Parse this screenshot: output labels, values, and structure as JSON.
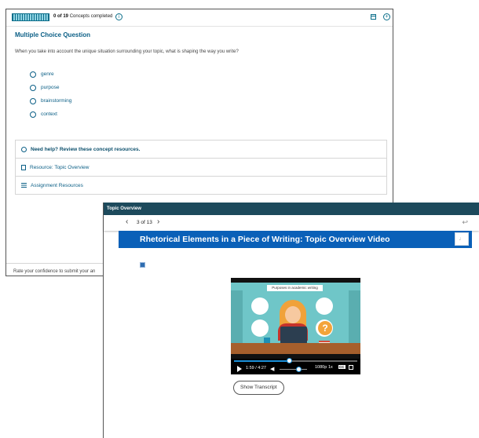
{
  "quiz": {
    "progress_fraction": 0.0,
    "concepts_prefix": "0 of 19",
    "concepts_suffix": "Concepts completed",
    "info_icon": "info-icon",
    "calendar_icon": "calendar-icon",
    "add_icon": "plus-circle-icon",
    "question_type": "Multiple Choice Question",
    "question": "When you take into account the unique situation surrounding your topic, what is shaping the way you write?",
    "options": [
      "genre",
      "purpose",
      "brainstorming",
      "context"
    ],
    "help": {
      "heading": "Need help? Review these concept resources.",
      "resources": [
        {
          "label": "Resource: Topic Overview",
          "icon": "document-icon"
        },
        {
          "label": "Assignment Resources",
          "icon": "list-icon"
        }
      ]
    },
    "confidence_text": "Rate your confidence to submit your an"
  },
  "viewer": {
    "window_title": "Topic Overview",
    "prev_icon": "chevron-left-icon",
    "counter": "3 of 13",
    "next_icon": "chevron-right-icon",
    "back_icon": "back-arrow-icon",
    "video_title": "Rhetorical Elements in a Piece of Writing: Topic Overview Video",
    "audio_icon": "speaker-icon",
    "video": {
      "slide_label": "Purposes in academic writing",
      "time": "1:59 / 4:27",
      "progress_fraction": 0.446,
      "volume_fraction": 0.7,
      "quality": "1080p",
      "speed": "1x",
      "cc": "CC"
    },
    "transcript_button": "Show Transcript"
  },
  "colors": {
    "primary_blue": "#0b5f86",
    "banner_blue": "#0a60b8",
    "titlebar": "#1d4a5c"
  }
}
